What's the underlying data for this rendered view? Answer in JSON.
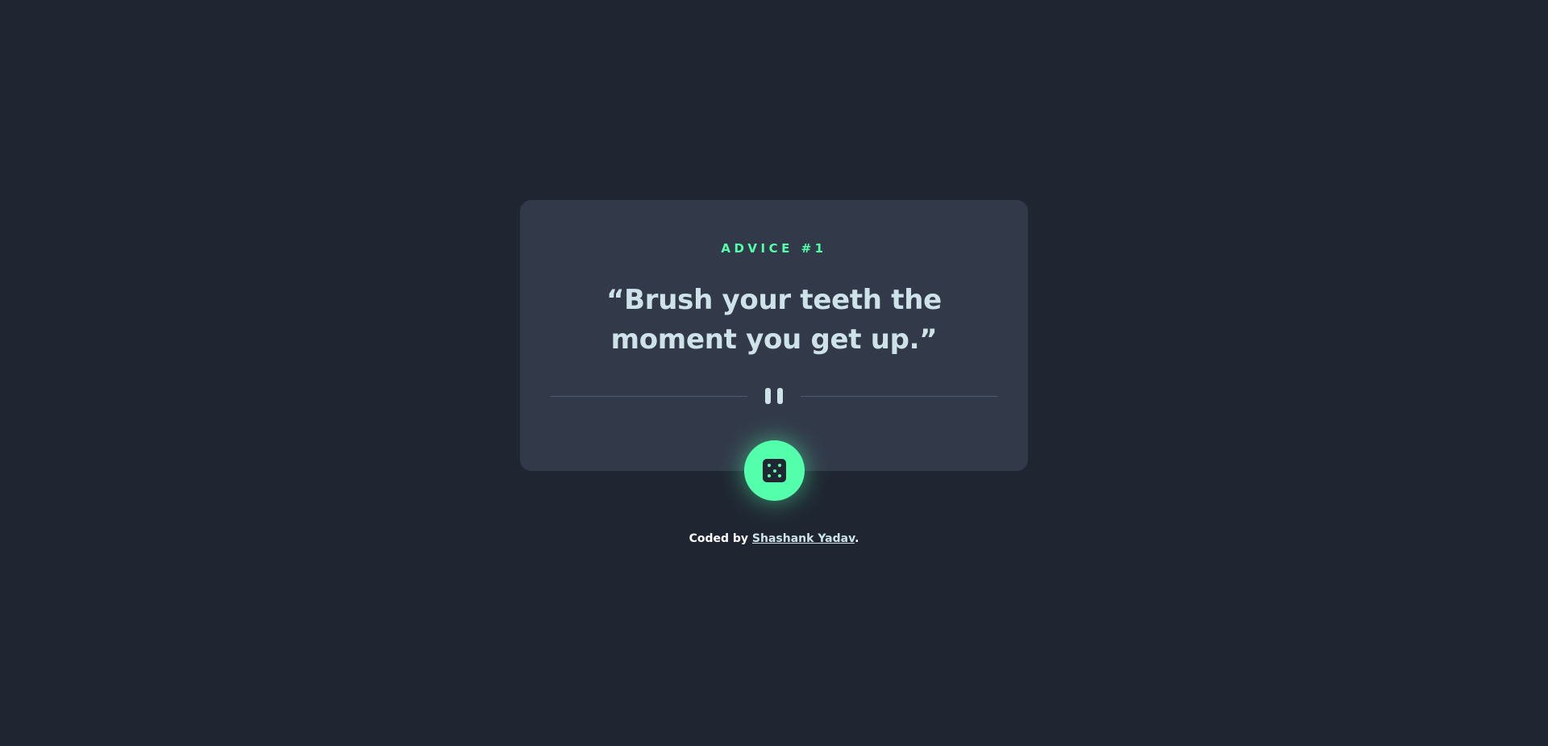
{
  "card": {
    "advice_label": "ADVICE #1",
    "quote": "“Brush your teeth the moment you get up.”"
  },
  "divider": {
    "icon": "pause-icon"
  },
  "dice_button": {
    "icon": "dice-icon"
  },
  "footer": {
    "prefix": "Coded by ",
    "author_link": "Shashank Yadav",
    "suffix": "."
  },
  "colors": {
    "background": "#1f2632",
    "card": "#323a4a",
    "accent": "#53ffaa",
    "text": "#cee3e9",
    "divider": "#4f5d74"
  }
}
